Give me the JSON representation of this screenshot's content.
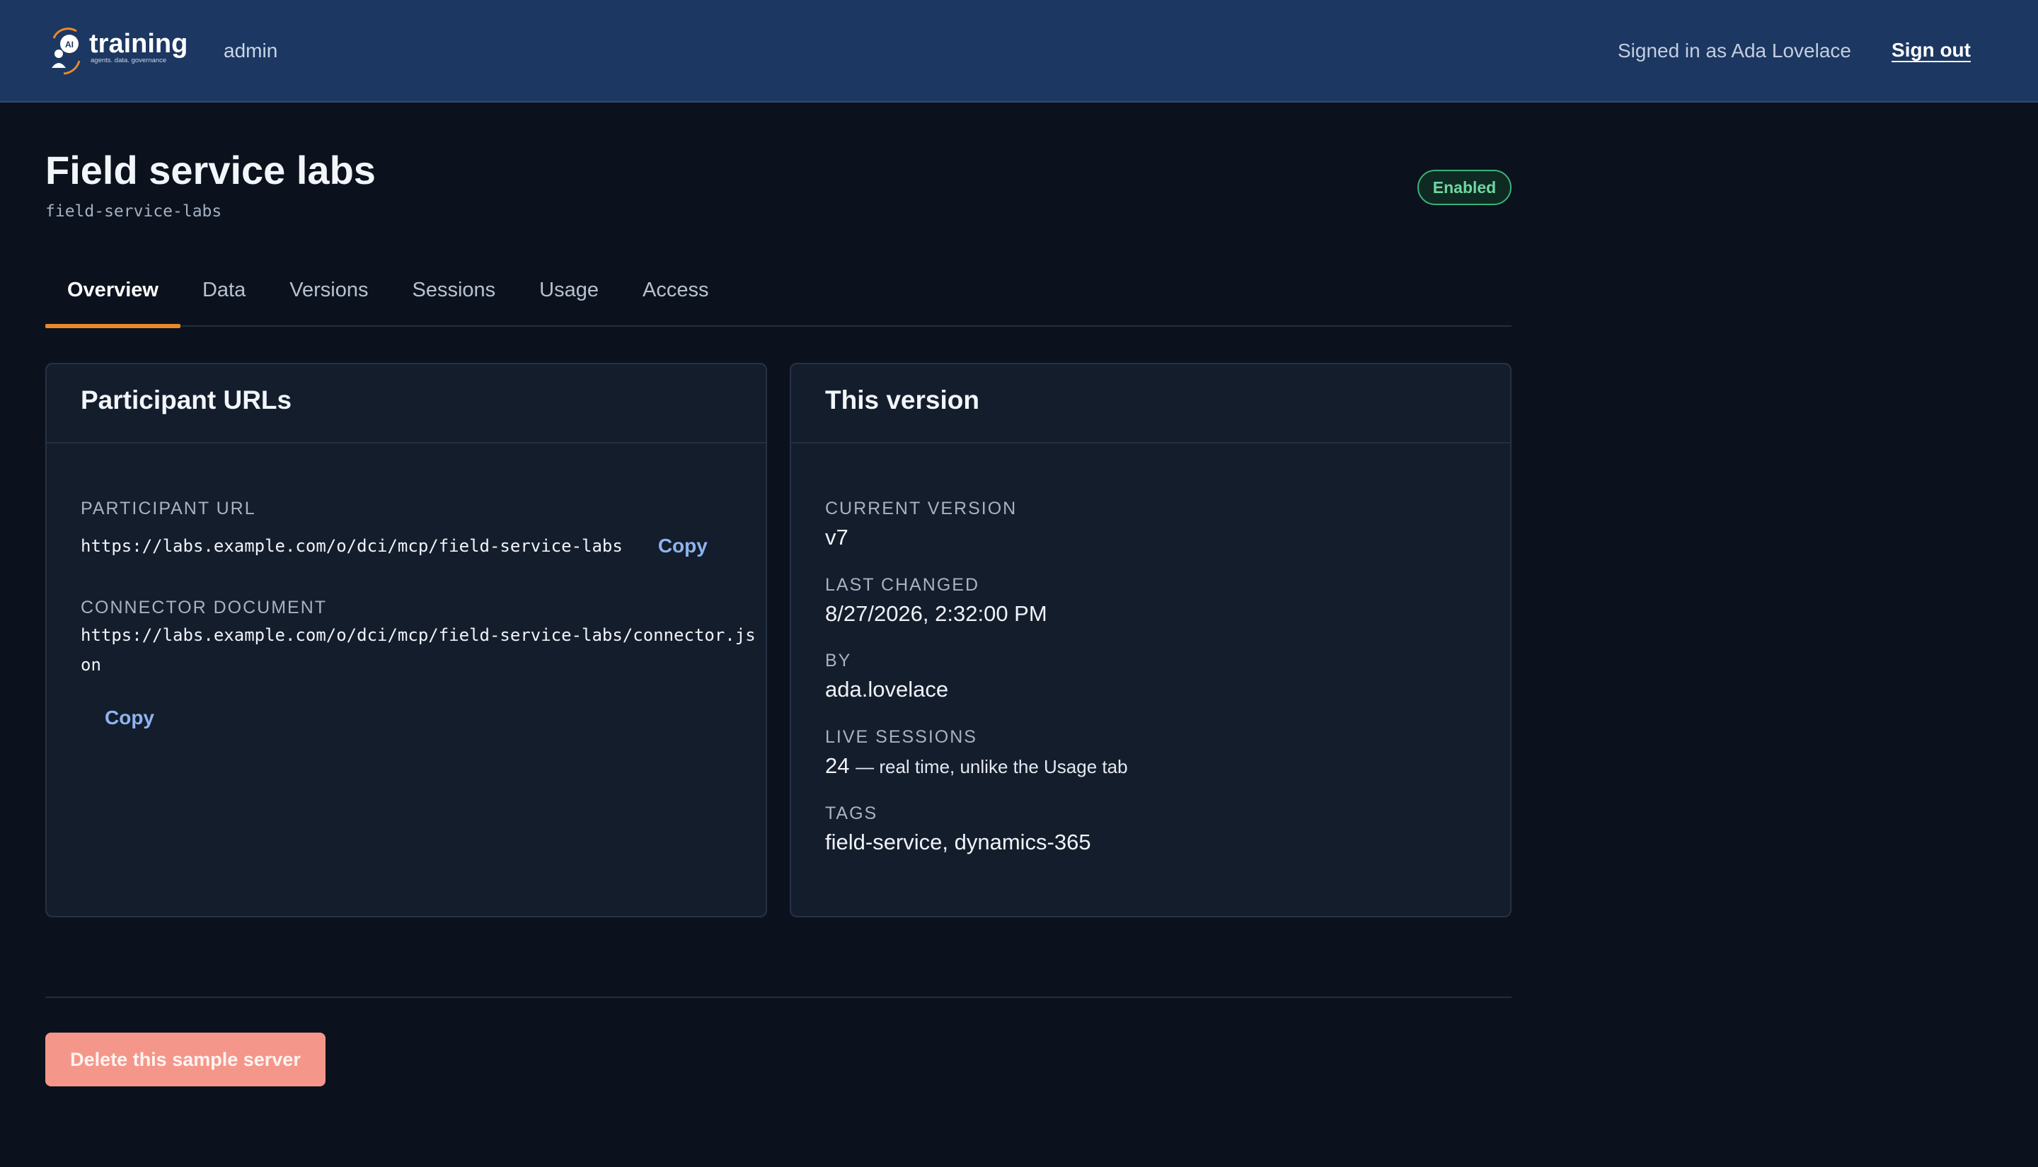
{
  "header": {
    "brand": "training",
    "brand_tagline": "agents. data. governance",
    "brand_badge": "AI",
    "section_label": "admin",
    "signed_in_text": "Signed in as Ada Lovelace",
    "sign_out_label": "Sign out"
  },
  "server": {
    "title": "Field service labs",
    "slug": "field-service-labs",
    "status": "Enabled"
  },
  "tabs": [
    {
      "label": "Overview",
      "active": true
    },
    {
      "label": "Data",
      "active": false
    },
    {
      "label": "Versions",
      "active": false
    },
    {
      "label": "Sessions",
      "active": false
    },
    {
      "label": "Usage",
      "active": false
    },
    {
      "label": "Access",
      "active": false
    }
  ],
  "participant_urls": {
    "title": "Participant URLs",
    "participant_url_label": "PARTICIPANT URL",
    "participant_url": "https://labs.example.com/o/dci/mcp/field-service-labs",
    "connector_label": "CONNECTOR DOCUMENT",
    "connector_url_line1": "https://labs.example.com/o/dci/mcp/field-service-labs/connector.js",
    "connector_url_line2": "on",
    "copy_label": "Copy"
  },
  "this_version": {
    "title": "This version",
    "current_version_label": "CURRENT VERSION",
    "current_version": "v7",
    "last_changed_label": "LAST CHANGED",
    "last_changed": "8/27/2026, 2:32:00 PM",
    "by_label": "BY",
    "by": "ada.lovelace",
    "live_sessions_label": "LIVE SESSIONS",
    "live_sessions": "24",
    "live_sessions_note": "— real time, unlike the Usage tab",
    "tags_label": "TAGS",
    "tags": "field-service, dynamics-365"
  },
  "footer": {
    "delete_label": "Delete this sample server"
  },
  "colors": {
    "header_bg": "#1c3761",
    "page_bg": "#0c121d",
    "accent_tab": "#e88a2a",
    "status_green": "#3bb27a",
    "danger": "#f4978a",
    "link": "#8fb4ee"
  }
}
